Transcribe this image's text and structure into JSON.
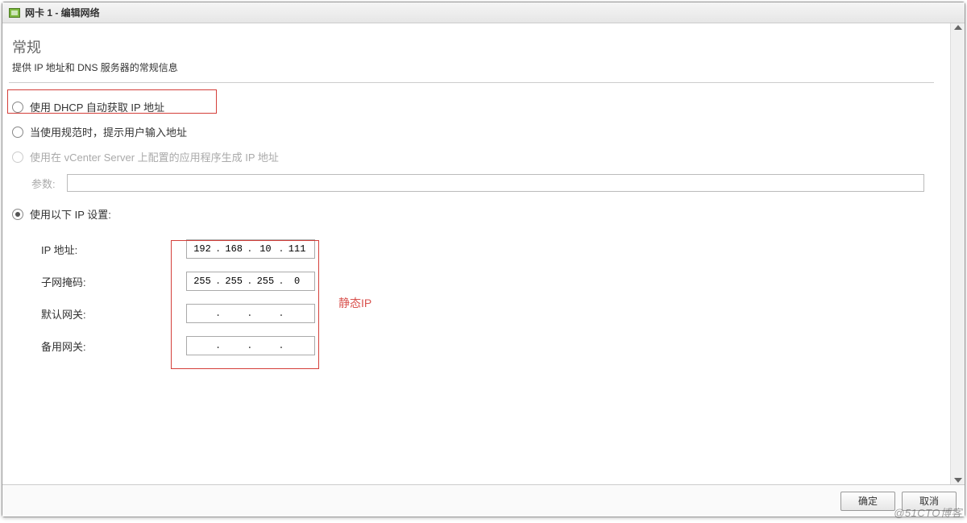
{
  "window": {
    "title": "网卡 1 - 编辑网络"
  },
  "section": {
    "title": "常规",
    "description": "提供 IP 地址和 DNS 服务器的常规信息"
  },
  "options": {
    "dhcp": {
      "label": "使用 DHCP 自动获取 IP 地址",
      "selected": false
    },
    "prompt": {
      "label": "当使用规范时，提示用户输入地址",
      "selected": false
    },
    "vcenter": {
      "label": "使用在 vCenter Server 上配置的应用程序生成 IP 地址",
      "selected": false,
      "disabled": true
    },
    "static": {
      "label": "使用以下 IP 设置:",
      "selected": true
    }
  },
  "params": {
    "label": "参数:",
    "value": ""
  },
  "ip_settings": {
    "ip": {
      "label": "IP 地址:",
      "oct": [
        "192",
        "168",
        "10",
        "111"
      ]
    },
    "subnet": {
      "label": "子网掩码:",
      "oct": [
        "255",
        "255",
        "255",
        "0"
      ]
    },
    "gateway": {
      "label": "默认网关:",
      "oct": [
        "",
        "",
        "",
        ""
      ]
    },
    "alt_gateway": {
      "label": "备用网关:",
      "oct": [
        "",
        "",
        "",
        ""
      ]
    }
  },
  "annotation": "静态IP",
  "footer": {
    "ok": "确定",
    "cancel": "取消"
  },
  "watermark": "@51CTO博客"
}
